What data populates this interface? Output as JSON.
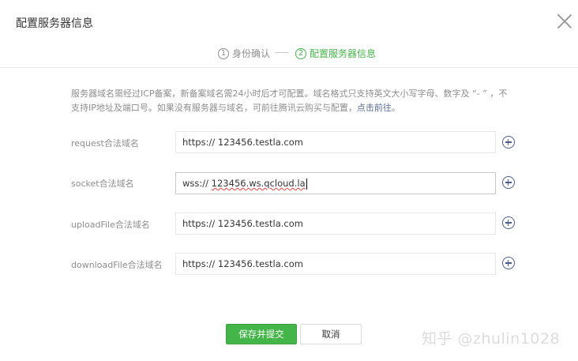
{
  "dialog": {
    "title": "配置服务器信息"
  },
  "steps": [
    {
      "num": "1",
      "label": "身份确认",
      "active": false
    },
    {
      "num": "2",
      "label": "配置服务器信息",
      "active": true
    }
  ],
  "notice": {
    "text_part1": "服务器域名需经过ICP备案，新备案域名需24小时后才可配置。域名格式只支持英文大小写字母、数字及 “- ” ，不支持IP地址及端口号。如果没有服务器与域名，可前往腾讯云购买与配置，",
    "link": "点击前往",
    "text_part2": "。"
  },
  "fields": [
    {
      "label": "request合法域名",
      "value": "https:// 123456.testla.com"
    },
    {
      "label": "socket合法域名",
      "prefix": "wss:// ",
      "value": "123456.ws.qcloud.la"
    },
    {
      "label": "uploadFile合法域名",
      "value": "https:// 123456.testla.com"
    },
    {
      "label": "downloadFile合法域名",
      "value": "https:// 123456.testla.com"
    }
  ],
  "actions": {
    "submit": "保存并提交",
    "cancel": "取消"
  },
  "watermark": "知乎 @zhulin1028",
  "colors": {
    "accent": "#44b549",
    "link": "#576b95"
  }
}
